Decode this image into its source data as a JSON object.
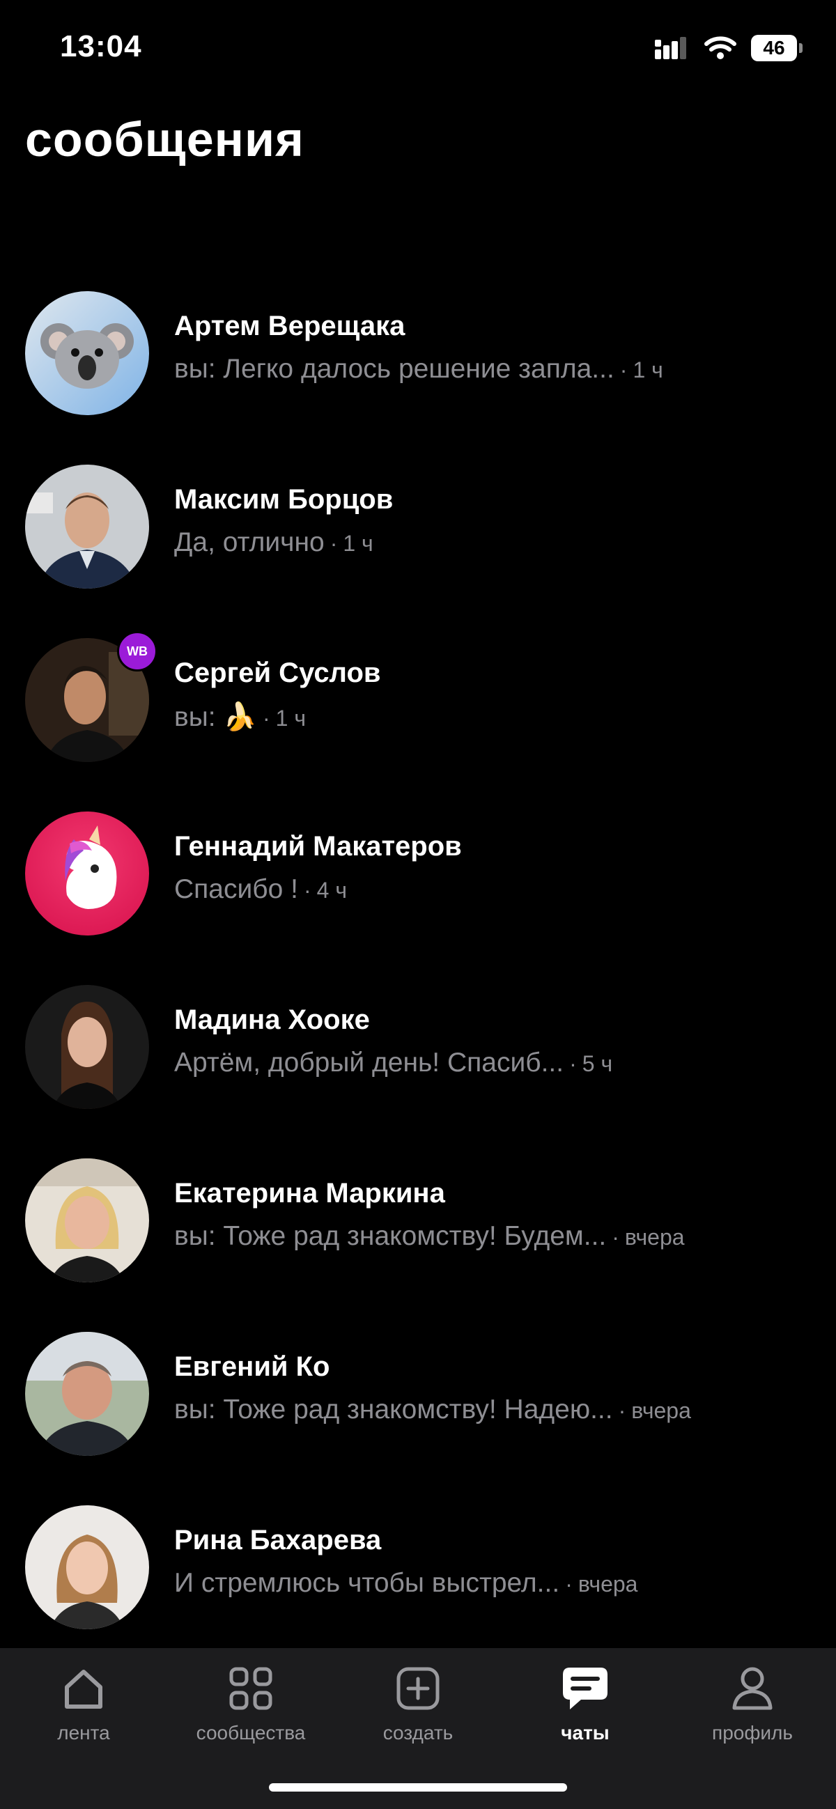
{
  "status_bar": {
    "time": "13:04",
    "battery": "46"
  },
  "header": {
    "title": "сообщения"
  },
  "chats": [
    {
      "name": "Артем Верещака",
      "preview": "вы: Легко далось решение запла...",
      "time": "1 ч",
      "avatar": "koala-emoji"
    },
    {
      "name": "Максим Борцов",
      "preview": "Да, отлично",
      "time": "1 ч",
      "avatar": "photo"
    },
    {
      "name": "Сергей Суслов",
      "preview": "вы: 🍌",
      "time": "1 ч",
      "avatar": "photo",
      "badge": "WB"
    },
    {
      "name": "Геннадий Макатеров",
      "preview": "Спасибо !",
      "time": "4 ч",
      "avatar": "unicorn-emoji"
    },
    {
      "name": "Мадина Хооке",
      "preview": "Артём, добрый день! Спасиб...",
      "time": "5 ч",
      "avatar": "photo"
    },
    {
      "name": "Екатерина Маркина",
      "preview": "вы: Тоже рад знакомству! Будем...",
      "time": "вчера",
      "avatar": "photo"
    },
    {
      "name": "Евгений Ко",
      "preview": "вы: Тоже рад знакомству! Надею...",
      "time": "вчера",
      "avatar": "photo"
    },
    {
      "name": "Рина Бахарева",
      "preview": "И стремлюсь чтобы выстрел...",
      "time": "вчера",
      "avatar": "photo"
    }
  ],
  "tab_bar": {
    "tabs": [
      {
        "label": "лента",
        "icon": "home-icon"
      },
      {
        "label": "сообщества",
        "icon": "grid-icon"
      },
      {
        "label": "создать",
        "icon": "plus-square-icon"
      },
      {
        "label": "чаты",
        "icon": "chat-bubble-icon",
        "active": true
      },
      {
        "label": "профиль",
        "icon": "person-icon"
      }
    ]
  },
  "colors": {
    "background": "#000000",
    "tab_bar": "#1c1c1e",
    "secondary_text": "#8e8e93",
    "badge": "#9b1bd8"
  }
}
